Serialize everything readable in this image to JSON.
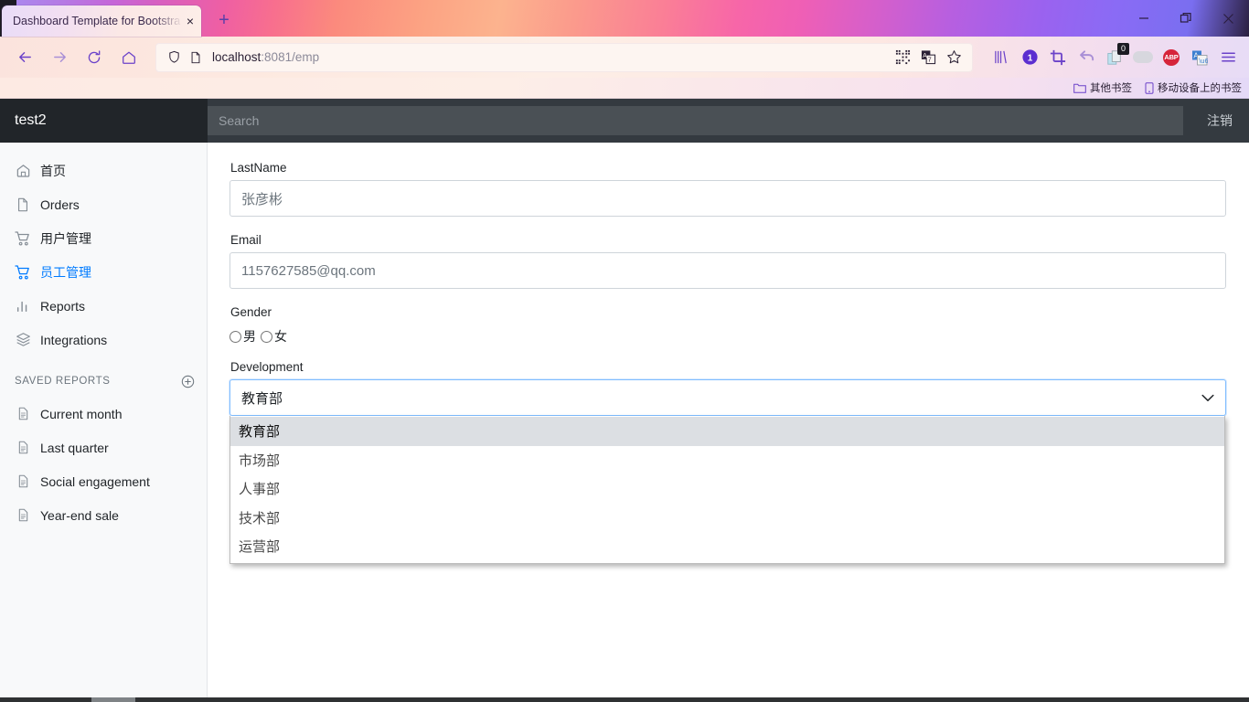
{
  "browser": {
    "tab": {
      "title": "Dashboard Template for Bootstra",
      "close_label": "×"
    },
    "newtab_label": "+",
    "window_controls": {
      "minimize": "—",
      "restore": "restore-icon",
      "close": "✕"
    },
    "nav": {
      "back_icon": "back-arrow-icon",
      "forward_icon": "forward-arrow-icon",
      "reload_icon": "reload-icon",
      "home_icon": "home-icon"
    },
    "url": {
      "host": "localhost",
      "rest": ":8081/emp"
    },
    "urlbar_icons": [
      "shield-icon",
      "page-icon",
      "qr-code-icon",
      "translate-icon",
      "bookmark-star-icon"
    ],
    "extensions": [
      {
        "name": "library-icon",
        "badge": ""
      },
      {
        "name": "counter-circle-icon",
        "badge": "1"
      },
      {
        "name": "crop-screenshot-icon",
        "badge": ""
      },
      {
        "name": "undo-arrow-icon",
        "badge": ""
      },
      {
        "name": "clipboard-icon",
        "badge": "0"
      },
      {
        "name": "pills-toggle-icon",
        "badge": ""
      },
      {
        "name": "adblock-plus-icon",
        "badge": "ABP"
      },
      {
        "name": "translate-extension-icon",
        "badge": ""
      },
      {
        "name": "app-menu-icon",
        "badge": ""
      }
    ],
    "bookmarks": [
      {
        "label": "其他书签",
        "icon": "folder-icon"
      },
      {
        "label": "移动设备上的书签",
        "icon": "mobile-icon"
      }
    ]
  },
  "app": {
    "brand": "test2",
    "search": {
      "value": "",
      "placeholder": "Search"
    },
    "logout_label": "注销",
    "colors": {
      "navbar": "#343a40",
      "brand_bg": "#212529",
      "search_bg": "#4a5055",
      "sidebar_bg": "#f8f9fa",
      "accent": "#007bff",
      "focus_border": "#80bdff"
    }
  },
  "sidebar": {
    "items": [
      {
        "label": "首页",
        "icon": "home-icon",
        "active": false
      },
      {
        "label": "Orders",
        "icon": "file-icon",
        "active": false
      },
      {
        "label": "用户管理",
        "icon": "shopping-cart-icon",
        "active": false
      },
      {
        "label": "员工管理",
        "icon": "shopping-cart-icon",
        "active": true
      },
      {
        "label": "Reports",
        "icon": "bar-chart-icon",
        "active": false
      },
      {
        "label": "Integrations",
        "icon": "layers-icon",
        "active": false
      }
    ],
    "section": {
      "title": "SAVED REPORTS",
      "add_icon": "plus-circle-icon"
    },
    "reports": [
      {
        "label": "Current month",
        "icon": "file-text-icon"
      },
      {
        "label": "Last quarter",
        "icon": "file-text-icon"
      },
      {
        "label": "Social engagement",
        "icon": "file-text-icon"
      },
      {
        "label": "Year-end sale",
        "icon": "file-text-icon"
      }
    ]
  },
  "form": {
    "lastname": {
      "label": "LastName",
      "value": "张彦彬"
    },
    "email": {
      "label": "Email",
      "value": "1157627585@qq.com"
    },
    "gender": {
      "label": "Gender",
      "options": [
        {
          "label": "男",
          "checked": false
        },
        {
          "label": "女",
          "checked": false
        }
      ]
    },
    "development": {
      "label": "Development",
      "value": "教育部",
      "open": true,
      "chevron_icon": "chevron-down-icon",
      "options": [
        {
          "label": "教育部",
          "selected": true
        },
        {
          "label": "市场部",
          "selected": false
        },
        {
          "label": "人事部",
          "selected": false
        },
        {
          "label": "技术部",
          "selected": false
        },
        {
          "label": "运营部",
          "selected": false
        }
      ]
    }
  }
}
